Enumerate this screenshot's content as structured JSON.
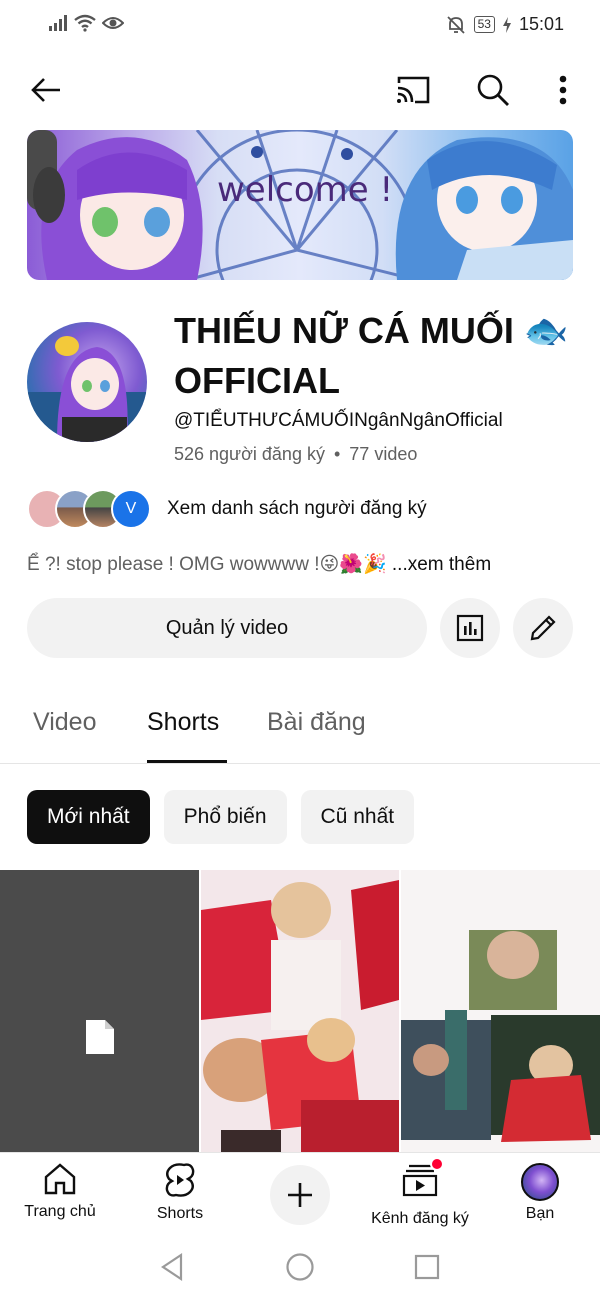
{
  "status_bar": {
    "time": "15:01",
    "battery": "53",
    "icons": [
      "signal-icon",
      "wifi-icon",
      "eye-icon",
      "mute-icon",
      "battery-icon",
      "charging-icon"
    ]
  },
  "app_bar": {
    "icons": [
      "back-arrow-icon",
      "cast-icon",
      "search-icon",
      "more-vert-icon"
    ]
  },
  "banner": {
    "text": "welcome !"
  },
  "channel": {
    "name": "THIẾU NỮ CÁ MUỐI 🐟OFFICIAL",
    "handle": "@TIỂUTHƯCÁMUỐINgânNgânOfficial",
    "subscribers": "526 người đăng ký",
    "separator": "•",
    "videos": "77 video",
    "subscribers_link": "Xem danh sách người đăng ký",
    "subscriber_avatar_letter": "V",
    "description": "Ể ?! stop please !  OMG wowwww !😜🌺🎉 ",
    "description_more": "...xem thêm"
  },
  "actions": {
    "manage_label": "Quản lý video",
    "icons": [
      "analytics-icon",
      "edit-pencil-icon"
    ]
  },
  "tabs": [
    {
      "label": "Video",
      "active": false
    },
    {
      "label": "Shorts",
      "active": true
    },
    {
      "label": "Bài đăng",
      "active": false
    }
  ],
  "chips": [
    {
      "label": "Mới nhất",
      "active": true
    },
    {
      "label": "Phổ biến",
      "active": false
    },
    {
      "label": "Cũ nhất",
      "active": false
    }
  ],
  "bottom_nav": [
    {
      "label": "Trang chủ",
      "icon": "home-icon"
    },
    {
      "label": "Shorts",
      "icon": "shorts-icon"
    },
    {
      "label": "",
      "icon": "create-plus-icon"
    },
    {
      "label": "Kênh đăng ký",
      "icon": "subscriptions-icon"
    },
    {
      "label": "Bạn",
      "icon": "profile-avatar-icon"
    }
  ],
  "colors": {
    "text_primary": "#0f0f0f",
    "text_secondary": "#606060",
    "chip_bg": "#f2f2f2",
    "notification_dot": "#ff0033",
    "subscriber_badge": "#1a73e8"
  }
}
